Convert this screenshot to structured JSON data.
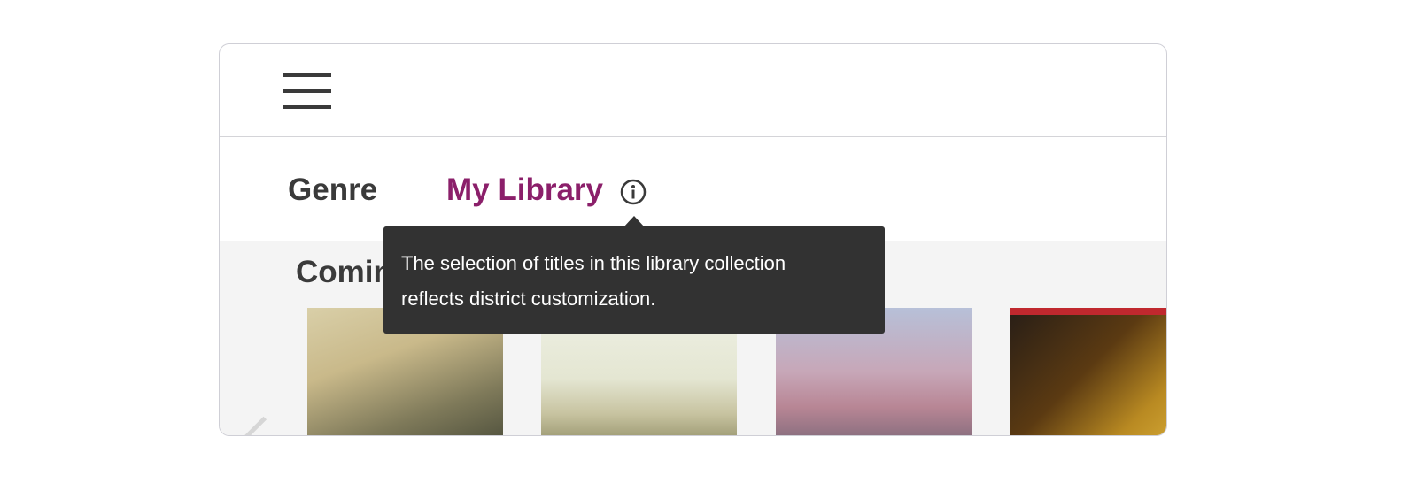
{
  "header": {
    "menu_icon": "hamburger-menu-icon"
  },
  "tabs": [
    {
      "label": "Genre",
      "active": false
    },
    {
      "label": "My Library",
      "active": true
    }
  ],
  "info_icon": "info-icon",
  "section": {
    "title": "Coming"
  },
  "tooltip": {
    "line1": "The selection of titles in this library collection",
    "line2": "reflects district customization."
  },
  "colors": {
    "active_tab": "#8b1f6a",
    "text": "#3a3a3a",
    "tooltip_bg": "#323232",
    "content_bg": "#f4f4f4"
  }
}
